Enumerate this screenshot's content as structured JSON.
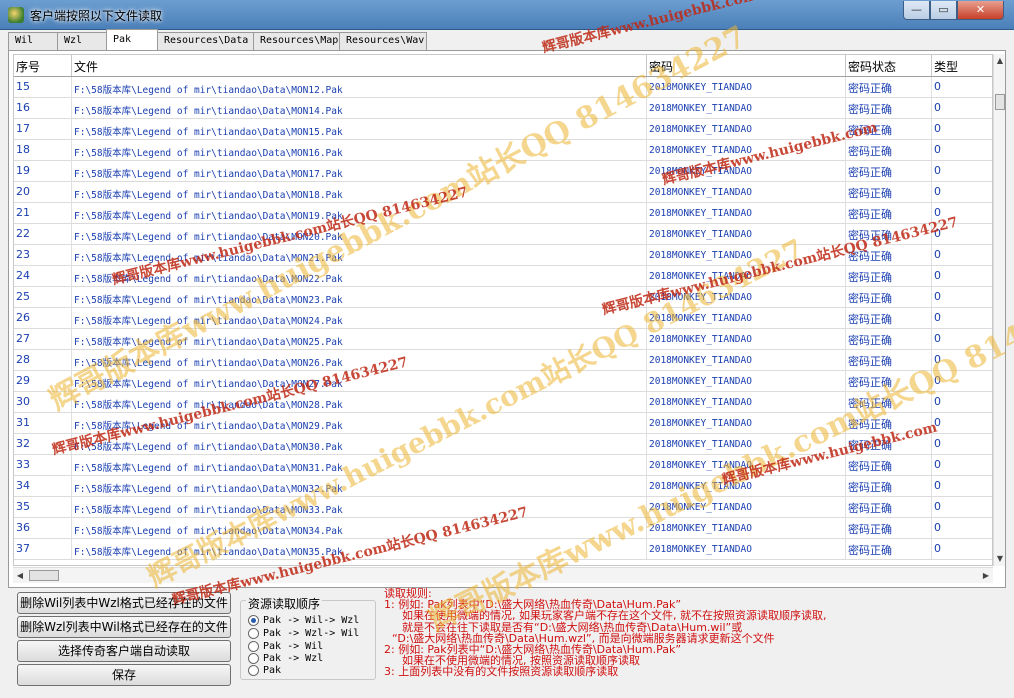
{
  "window": {
    "title": "客户端按照以下文件读取",
    "min_symbol": "—",
    "max_symbol": "▭",
    "close_symbol": "✕"
  },
  "tabs": [
    "Wil",
    "Wzl",
    "Pak",
    "Resources\\Data",
    "Resources\\Map",
    "Resources\\Wav"
  ],
  "active_tab": "Pak",
  "grid": {
    "headers": [
      "序号",
      "文件",
      "密码",
      "密码状态",
      "类型"
    ],
    "rows": [
      [
        "15",
        "F:\\58版本库\\Legend of mir\\tiandao\\Data\\MON12.Pak",
        "2018MONKEY_TIANDAO",
        "密码正确",
        "0"
      ],
      [
        "16",
        "F:\\58版本库\\Legend of mir\\tiandao\\Data\\MON14.Pak",
        "2018MONKEY_TIANDAO",
        "密码正确",
        "0"
      ],
      [
        "17",
        "F:\\58版本库\\Legend of mir\\tiandao\\Data\\MON15.Pak",
        "2018MONKEY_TIANDAO",
        "密码正确",
        "0"
      ],
      [
        "18",
        "F:\\58版本库\\Legend of mir\\tiandao\\Data\\MON16.Pak",
        "2018MONKEY_TIANDAO",
        "密码正确",
        "0"
      ],
      [
        "19",
        "F:\\58版本库\\Legend of mir\\tiandao\\Data\\MON17.Pak",
        "2018MONKEY_TIANDAO",
        "密码正确",
        "0"
      ],
      [
        "20",
        "F:\\58版本库\\Legend of mir\\tiandao\\Data\\MON18.Pak",
        "2018MONKEY_TIANDAO",
        "密码正确",
        "0"
      ],
      [
        "21",
        "F:\\58版本库\\Legend of mir\\tiandao\\Data\\MON19.Pak",
        "2018MONKEY_TIANDAO",
        "密码正确",
        "0"
      ],
      [
        "22",
        "F:\\58版本库\\Legend of mir\\tiandao\\Data\\MON20.Pak",
        "2018MONKEY_TIANDAO",
        "密码正确",
        "0"
      ],
      [
        "23",
        "F:\\58版本库\\Legend of mir\\tiandao\\Data\\MON21.Pak",
        "2018MONKEY_TIANDAO",
        "密码正确",
        "0"
      ],
      [
        "24",
        "F:\\58版本库\\Legend of mir\\tiandao\\Data\\MON22.Pak",
        "2018MONKEY_TIANDAO",
        "密码正确",
        "0"
      ],
      [
        "25",
        "F:\\58版本库\\Legend of mir\\tiandao\\Data\\MON23.Pak",
        "2018MONKEY_TIANDAO",
        "密码正确",
        "0"
      ],
      [
        "26",
        "F:\\58版本库\\Legend of mir\\tiandao\\Data\\MON24.Pak",
        "2018MONKEY_TIANDAO",
        "密码正确",
        "0"
      ],
      [
        "27",
        "F:\\58版本库\\Legend of mir\\tiandao\\Data\\MON25.Pak",
        "2018MONKEY_TIANDAO",
        "密码正确",
        "0"
      ],
      [
        "28",
        "F:\\58版本库\\Legend of mir\\tiandao\\Data\\MON26.Pak",
        "2018MONKEY_TIANDAO",
        "密码正确",
        "0"
      ],
      [
        "29",
        "F:\\58版本库\\Legend of mir\\tiandao\\Data\\MON27.Pak",
        "2018MONKEY_TIANDAO",
        "密码正确",
        "0"
      ],
      [
        "30",
        "F:\\58版本库\\Legend of mir\\tiandao\\Data\\MON28.Pak",
        "2018MONKEY_TIANDAO",
        "密码正确",
        "0"
      ],
      [
        "31",
        "F:\\58版本库\\Legend of mir\\tiandao\\Data\\MON29.Pak",
        "2018MONKEY_TIANDAO",
        "密码正确",
        "0"
      ],
      [
        "32",
        "F:\\58版本库\\Legend of mir\\tiandao\\Data\\MON30.Pak",
        "2018MONKEY_TIANDAO",
        "密码正确",
        "0"
      ],
      [
        "33",
        "F:\\58版本库\\Legend of mir\\tiandao\\Data\\MON31.Pak",
        "2018MONKEY_TIANDAO",
        "密码正确",
        "0"
      ],
      [
        "34",
        "F:\\58版本库\\Legend of mir\\tiandao\\Data\\MON32.Pak",
        "2018MONKEY_TIANDAO",
        "密码正确",
        "0"
      ],
      [
        "35",
        "F:\\58版本库\\Legend of mir\\tiandao\\Data\\MON33.Pak",
        "2018MONKEY_TIANDAO",
        "密码正确",
        "0"
      ],
      [
        "36",
        "F:\\58版本库\\Legend of mir\\tiandao\\Data\\MON34.Pak",
        "2018MONKEY_TIANDAO",
        "密码正确",
        "0"
      ],
      [
        "37",
        "F:\\58版本库\\Legend of mir\\tiandao\\Data\\MON35.Pak",
        "2018MONKEY_TIANDAO",
        "密码正确",
        "0"
      ]
    ]
  },
  "buttons": {
    "delete_wil": "删除Wil列表中Wzl格式已经存在的文件",
    "delete_wzl": "删除Wzl列表中Wil格式已经存在的文件",
    "select_client": "选择传奇客户端自动读取",
    "save": "保存"
  },
  "read_order": {
    "label": "资源读取顺序",
    "options": [
      "Pak -> Wil-> Wzl",
      "Pak -> Wzl-> Wil",
      "Pak -> Wil",
      "Pak -> Wzl",
      "Pak"
    ],
    "selected_index": 0
  },
  "rules": {
    "heading": "读取规则:",
    "line1": "1: 例如: Pak列表中“D:\\盛大网络\\热血传奇\\Data\\Hum.Pak”",
    "line1a": "如果在使用微端的情况, 如果玩家客户端不存在这个文件, 就不在按照资源读取顺序读取,",
    "line1b": "就是不会在往下读取是否有“D:\\盛大网络\\热血传奇\\Data\\Hum.wil”或",
    "line1c": "“D:\\盛大网络\\热血传奇\\Data\\Hum.wzl”, 而是向微端服务器请求更新这个文件",
    "line2": "2: 例如: Pak列表中“D:\\盛大网络\\热血传奇\\Data\\Hum.Pak”",
    "line2a": "如果在不使用微端的情况, 按照资源读取顺序读取",
    "line3": "3: 上面列表中没有的文件按照资源读取顺序读取"
  },
  "watermark": {
    "site": "辉哥版本库www.huigebbk.com站长QQ 814634227",
    "short": "辉哥版本库www.huigebbk.com"
  }
}
